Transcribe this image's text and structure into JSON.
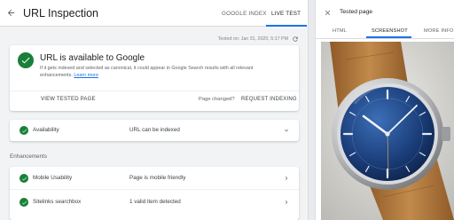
{
  "header": {
    "title": "URL Inspection",
    "tabs": [
      {
        "label": "GOOGLE INDEX"
      },
      {
        "label": "LIVE TEST"
      }
    ],
    "tested_on": "Tested on: Jan 31, 2020, 5:17 PM"
  },
  "status_card": {
    "title": "URL is available to Google",
    "description": "If it gets indexed and selected as canonical, it could appear in Google Search results with all relevant enhancements.",
    "learn_more": "Learn more",
    "view_tested_page": "VIEW TESTED PAGE",
    "page_changed": "Page changed?",
    "request_indexing": "REQUEST INDEXING"
  },
  "availability": {
    "label": "Availability",
    "value": "URL can be indexed"
  },
  "enhancements": {
    "section_label": "Enhancements",
    "rows": [
      {
        "label": "Mobile Usability",
        "value": "Page is mobile friendly"
      },
      {
        "label": "Sitelinks searchbox",
        "value": "1 valid item detected"
      }
    ]
  },
  "tested_page_panel": {
    "title": "Tested page",
    "tabs": [
      {
        "label": "HTML"
      },
      {
        "label": "SCREENSHOT"
      },
      {
        "label": "MORE INFO"
      }
    ]
  },
  "colors": {
    "accent": "#1a73e8",
    "success": "#188038",
    "watch_dial": "#1b3e7a",
    "strap": "#b98244"
  }
}
